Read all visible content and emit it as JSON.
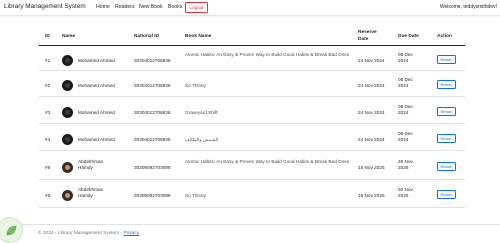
{
  "navbar": {
    "brand": "Library Management System",
    "links": [
      "Home",
      "Readers",
      "New Book",
      "Books"
    ],
    "logout": "Logout",
    "welcome": "Welcome, teddysmithdev!"
  },
  "table": {
    "headers": [
      "ID",
      "Name",
      "National ID",
      "Book Name",
      "Reserve Date",
      "Due Date",
      "Action"
    ],
    "rows": [
      {
        "id": "#1",
        "name": "Mohamed Ahmed",
        "national_id": "30304012706836",
        "book": "Atomic Habits: An Easy & Proven Way to Build Good Habits & Break Bad Ones",
        "reserve_date": "24 Nov 2024",
        "due_date": "08 Dec 2024",
        "action": "Return",
        "avatar": "dark-logo-avatar"
      },
      {
        "id": "#2",
        "name": "Mohamed Ahmed",
        "national_id": "30304012706836",
        "book": "So Thirsty",
        "reserve_date": "24 Nov 2024",
        "due_date": "08 Dec 2024",
        "action": "Return",
        "avatar": "dark-logo-avatar"
      },
      {
        "id": "#3",
        "name": "Mohamed Ahmed",
        "national_id": "30304012706836",
        "book": "Graveyard Shift",
        "reserve_date": "24 Nov 2024",
        "due_date": "08 Dec 2024",
        "action": "Return",
        "avatar": "dark-logo-avatar"
      },
      {
        "id": "#4",
        "name": "Mohamed Ahmed",
        "national_id": "30304012706836",
        "book": "الشمس والتكاثف",
        "reserve_date": "24 Nov 2024",
        "due_date": "08 Dec 2024",
        "action": "Return",
        "avatar": "dark-logo-avatar"
      },
      {
        "id": "#5",
        "name": "Abdelrhman Hamdy",
        "national_id": "30309092703099",
        "book": "Atomic Habits: An Easy & Proven Way to Build Good Habits & Break Bad Ones",
        "reserve_date": "16 Nov 2025",
        "due_date": "30 Nov 2025",
        "action": "Return",
        "avatar": "person-photo-avatar"
      },
      {
        "id": "#6",
        "name": "Abdelrhman Hamdy",
        "national_id": "30309092703099",
        "book": "So Thirsty",
        "reserve_date": "16 Nov 2025",
        "due_date": "30 Nov 2025",
        "action": "Return",
        "avatar": "person-photo-avatar"
      }
    ]
  },
  "footer": {
    "text": "© 2024 - Library Management System -",
    "privacy": "Privacy"
  },
  "colors": {
    "accent": "#0d6efd",
    "danger": "#dc3545",
    "muted": "#6c757d",
    "border": "#dee2e6"
  },
  "icons": {
    "badge": "leaf-badge-icon"
  }
}
